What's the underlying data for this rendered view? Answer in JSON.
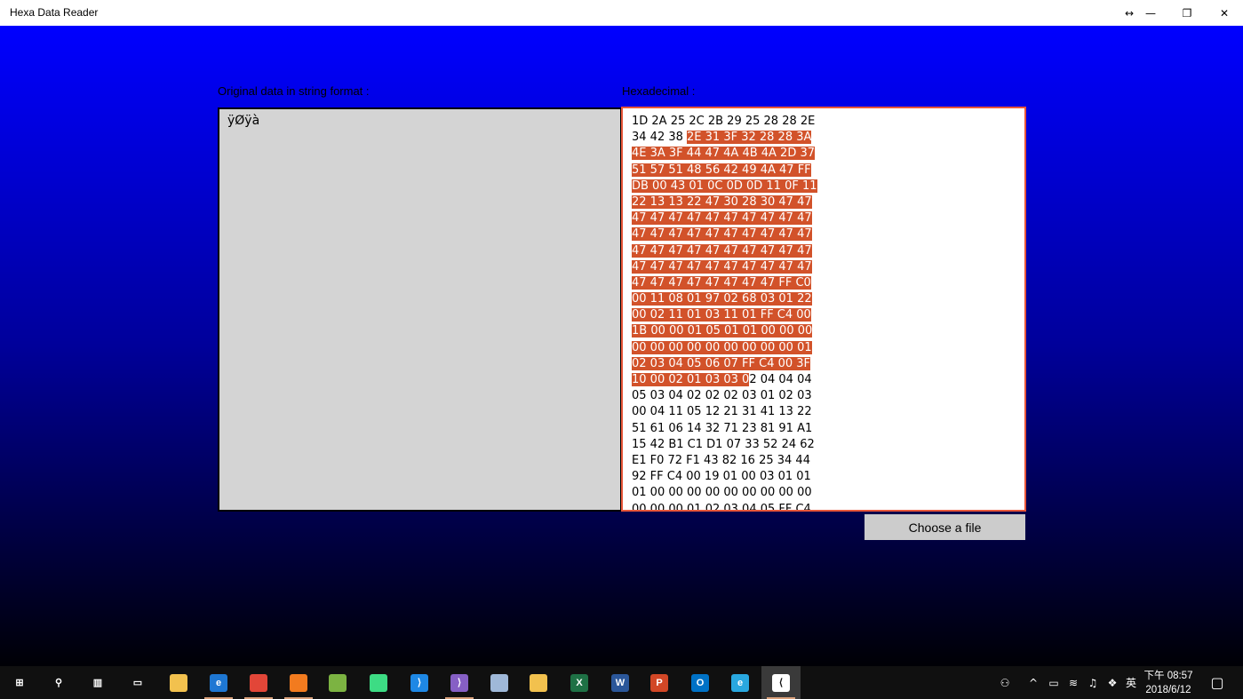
{
  "window": {
    "title": "Hexa Data Reader",
    "controls": {
      "resize": "↔",
      "minimize": "—",
      "restore": "❐",
      "close": "✕"
    }
  },
  "app": {
    "left_label": "Original data in string format :",
    "right_label": "Hexadecimal :",
    "string_data": "ÿØÿà",
    "hex_lines": [
      {
        "pre": "1D 2A 25 2C 2B 29 25 28 28 2E",
        "sel": "",
        "post": ""
      },
      {
        "pre": "34 42 38 ",
        "sel": "2E 31 3F 32 28 28 3A",
        "post": ""
      },
      {
        "pre": "",
        "sel": "4E 3A 3F 44 47 4A 4B 4A 2D 37",
        "post": ""
      },
      {
        "pre": "",
        "sel": "51 57 51 48 56 42 49 4A 47 FF",
        "post": ""
      },
      {
        "pre": "",
        "sel": "DB 00 43 01 0C 0D 0D 11 0F 11",
        "post": ""
      },
      {
        "pre": "",
        "sel": "22 13 13 22 47 30 28 30 47 47",
        "post": ""
      },
      {
        "pre": "",
        "sel": "47 47 47 47 47 47 47 47 47 47",
        "post": ""
      },
      {
        "pre": "",
        "sel": "47 47 47 47 47 47 47 47 47 47",
        "post": ""
      },
      {
        "pre": "",
        "sel": "47 47 47 47 47 47 47 47 47 47",
        "post": ""
      },
      {
        "pre": "",
        "sel": "47 47 47 47 47 47 47 47 47 47",
        "post": ""
      },
      {
        "pre": "",
        "sel": "47 47 47 47 47 47 47 47 FF C0",
        "post": ""
      },
      {
        "pre": "",
        "sel": "00 11 08 01 97 02 68 03 01 22",
        "post": ""
      },
      {
        "pre": "",
        "sel": "00 02 11 01 03 11 01 FF C4 00",
        "post": ""
      },
      {
        "pre": "",
        "sel": "1B 00 00 01 05 01 01 00 00 00",
        "post": ""
      },
      {
        "pre": "",
        "sel": "00 00 00 00 00 00 00 00 00 01",
        "post": ""
      },
      {
        "pre": "",
        "sel": "02 03 04 05 06 07 FF C4 00 3F",
        "post": ""
      },
      {
        "pre": "",
        "sel": "10 00 02 01 03 03 0",
        "post": "2 04 04 04"
      },
      {
        "pre": "05 03 04 02 02 02 03 01 02 03",
        "sel": "",
        "post": ""
      },
      {
        "pre": "00 04 11 05 12 21 31 41 13 22",
        "sel": "",
        "post": ""
      },
      {
        "pre": "51 61 06 14 32 71 23 81 91 A1",
        "sel": "",
        "post": ""
      },
      {
        "pre": "15 42 B1 C1 D1 07 33 52 24 62",
        "sel": "",
        "post": ""
      },
      {
        "pre": "E1 F0 72 F1 43 82 16 25 34 44",
        "sel": "",
        "post": ""
      },
      {
        "pre": "92 FF C4 00 19 01 00 03 01 01",
        "sel": "",
        "post": ""
      },
      {
        "pre": "01 00 00 00 00 00 00 00 00 00",
        "sel": "",
        "post": ""
      },
      {
        "pre": "00 00 00 01 02 03 04 05 FF C4",
        "sel": "",
        "post": ""
      }
    ],
    "choose_button": "Choose a file"
  },
  "colors": {
    "selection": "#d2522a",
    "focus_border": "#e8573a",
    "gradient_top": "#0000ff",
    "gradient_bottom": "#000005"
  },
  "taskbar": {
    "icons": [
      {
        "name": "start-icon",
        "glyph": "⊞",
        "color": "#101010"
      },
      {
        "name": "search-icon",
        "glyph": "⚲",
        "color": "#101010"
      },
      {
        "name": "task-view-icon",
        "glyph": "▥",
        "color": "#101010"
      },
      {
        "name": "terminal-icon",
        "glyph": "▭",
        "color": "#101010"
      },
      {
        "name": "file-explorer-icon",
        "glyph": "",
        "color": "#f2c14e"
      },
      {
        "name": "edge-icon",
        "glyph": "e",
        "color": "#1e77d3"
      },
      {
        "name": "chrome-icon",
        "glyph": "",
        "color": "#e24638"
      },
      {
        "name": "firefox-icon",
        "glyph": "",
        "color": "#f27b1f"
      },
      {
        "name": "notepad-icon",
        "glyph": "",
        "color": "#7cb342"
      },
      {
        "name": "android-studio-icon",
        "glyph": "",
        "color": "#3ddc84"
      },
      {
        "name": "vscode-icon",
        "glyph": "⟩",
        "color": "#1e88e5"
      },
      {
        "name": "visual-studio-icon",
        "glyph": "⟩",
        "color": "#865fc5"
      },
      {
        "name": "cube-icon",
        "glyph": "",
        "color": "#9fb8d8"
      },
      {
        "name": "tools-icon",
        "glyph": "",
        "color": "#f2c14e"
      },
      {
        "name": "excel-icon",
        "glyph": "X",
        "color": "#1e7145"
      },
      {
        "name": "word-icon",
        "glyph": "W",
        "color": "#2b579a"
      },
      {
        "name": "powerpoint-icon",
        "glyph": "P",
        "color": "#d24726"
      },
      {
        "name": "outlook-icon",
        "glyph": "O",
        "color": "#0072c6"
      },
      {
        "name": "ie-icon",
        "glyph": "e",
        "color": "#29a8e0"
      },
      {
        "name": "hexa-reader-icon",
        "glyph": "⟨",
        "color": "#ffffff"
      }
    ],
    "tray": {
      "people_icon": "⚇",
      "chevron_up_icon": "^",
      "battery_icon": "▭",
      "wifi_icon": "≋",
      "volume_icon": "♫",
      "dropbox_icon": "❖",
      "ime": "英",
      "notification_icon": "▢"
    },
    "clock": {
      "time": "下午 08:57",
      "date": "2018/6/12"
    }
  }
}
